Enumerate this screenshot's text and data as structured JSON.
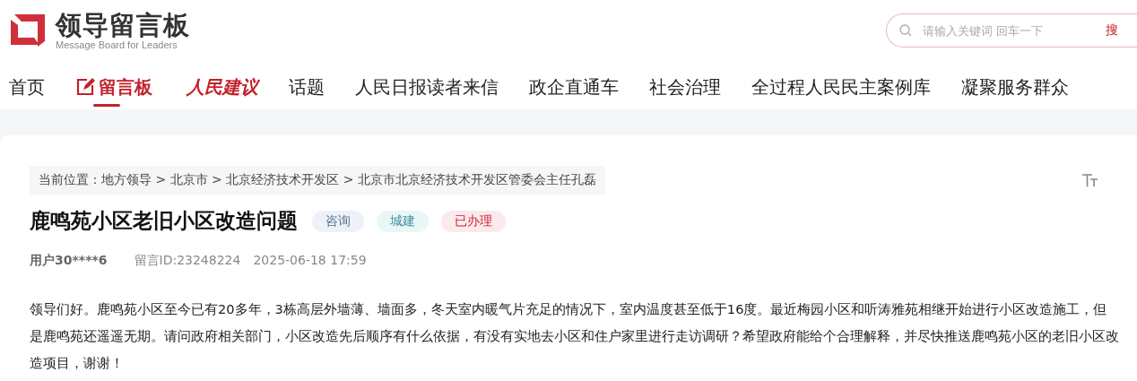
{
  "logo": {
    "title": "领导留言板",
    "subtitle": "Message Board for Leaders"
  },
  "search": {
    "placeholder": "请输入关键词 回车一下",
    "button": "搜"
  },
  "nav": [
    {
      "label": "首页",
      "kind": "text",
      "selected": false
    },
    {
      "label": "留言板",
      "kind": "icon",
      "selected": true
    },
    {
      "label": "人民建议",
      "kind": "brand",
      "selected": false
    },
    {
      "label": "话题",
      "kind": "text",
      "selected": false
    },
    {
      "label": "人民日报读者来信",
      "kind": "text",
      "selected": false
    },
    {
      "label": "政企直通车",
      "kind": "text",
      "selected": false
    },
    {
      "label": "社会治理",
      "kind": "text",
      "selected": false
    },
    {
      "label": "全过程人民民主案例库",
      "kind": "text",
      "selected": false
    },
    {
      "label": "凝聚服务群众",
      "kind": "text",
      "selected": false
    }
  ],
  "breadcrumb": "当前位置：地方领导 > 北京市 > 北京经济技术开发区 > 北京市北京经济技术开发区管委会主任孔磊",
  "message": {
    "title": "鹿鸣苑小区老旧小区改造问题",
    "tags": [
      {
        "label": "咨询",
        "color": "#eef2f8"
      },
      {
        "label": "城建",
        "color": "#e9f7f7"
      },
      {
        "label": "已办理",
        "color": "#fbe9ec"
      }
    ],
    "user": "用户30****6",
    "id": "留言ID:23248224",
    "time": "2025-06-18 17:59",
    "body": "领导们好。鹿鸣苑小区至今已有20多年，3栋高层外墙薄、墙面多，冬天室内暖气片充足的情况下，室内温度甚至低于16度。最近梅园小区和听涛雅苑相继开始进行小区改造施工，但是鹿鸣苑还遥遥无期。请问政府相关部门，小区改造先后顺序有什么依据，有没有实地去小区和住户家里进行走访调研？希望政府能给个合理解释，并尽快推送鹿鸣苑小区的老旧小区改造项目，谢谢！"
  }
}
